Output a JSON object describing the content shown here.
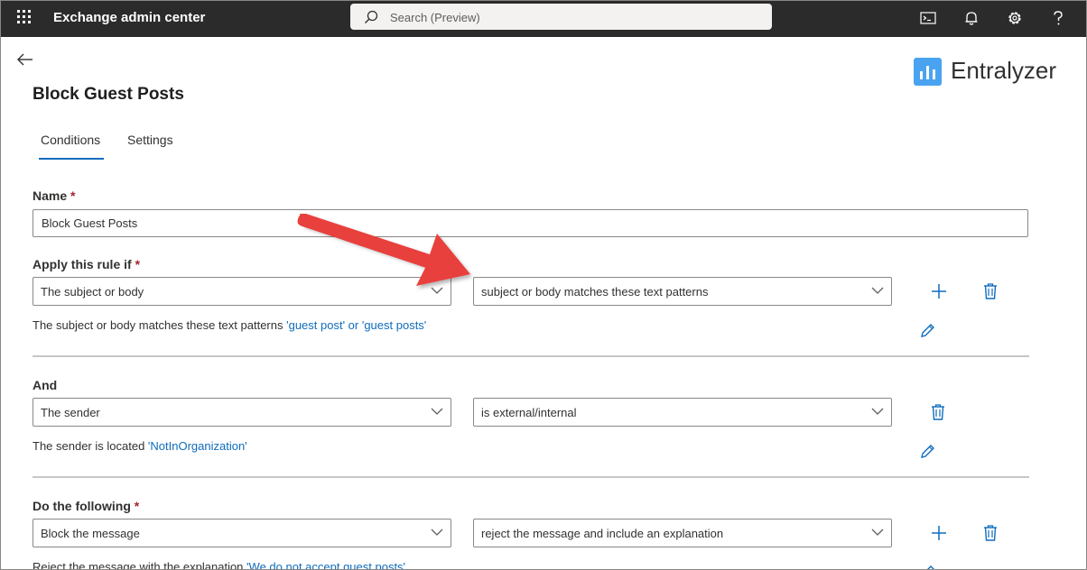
{
  "topbar": {
    "title": "Exchange admin center",
    "search_placeholder": "Search (Preview)",
    "icons": [
      "waffle-icon",
      "search-icon",
      "terminal-icon",
      "bell-icon",
      "gear-icon",
      "help-icon"
    ]
  },
  "brand": {
    "name": "Entralyzer",
    "color": "#4aa3f0"
  },
  "page": {
    "title": "Block Guest Posts"
  },
  "tabs": [
    {
      "label": "Conditions",
      "active": true
    },
    {
      "label": "Settings",
      "active": false
    }
  ],
  "form": {
    "name_label": "Name",
    "required_mark": "*",
    "name_value": "Block Guest Posts",
    "apply_label": "Apply this rule if",
    "apply_property": "The subject or body",
    "apply_condition": "subject or body matches these text patterns",
    "apply_desc": "The subject or body matches these text patterns",
    "apply_desc_link": "'guest post' or 'guest posts'",
    "and_label": "And",
    "and_property": "The sender",
    "and_condition": "is external/internal",
    "and_desc": "The sender is located",
    "and_desc_link": "'NotInOrganization'",
    "do_label": "Do the following",
    "do_action": "Block the message",
    "do_detail": "reject the message and include an explanation",
    "do_desc": "Reject the message with the explanation",
    "do_desc_link": "'We do not accept guest posts'"
  },
  "colors": {
    "accent": "#0f6cbd",
    "topbar": "#2b2b2b",
    "required": "#a4262c",
    "annotation_arrow": "#e8403d"
  }
}
